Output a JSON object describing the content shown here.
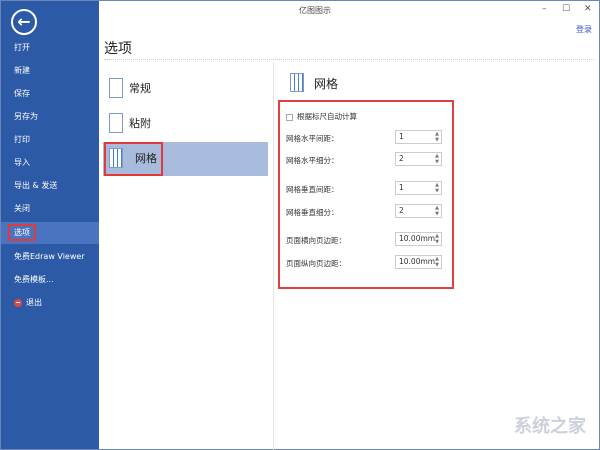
{
  "window": {
    "title": "亿图图示",
    "minimize": "–",
    "maximize": "☐",
    "close": "✕",
    "login": "登录"
  },
  "sidebar": {
    "back": "←",
    "items": [
      {
        "label": "打开"
      },
      {
        "label": "新建"
      },
      {
        "label": "保存"
      },
      {
        "label": "另存为"
      },
      {
        "label": "打印"
      },
      {
        "label": "导入"
      },
      {
        "label": "导出 & 发送"
      },
      {
        "label": "关闭"
      },
      {
        "label": "选项",
        "selected": true
      },
      {
        "label": "免费Edraw Viewer"
      },
      {
        "label": "免费模板..."
      },
      {
        "label": "退出"
      }
    ]
  },
  "page": {
    "title": "选项"
  },
  "categories": [
    {
      "label": "常规"
    },
    {
      "label": "粘附"
    },
    {
      "label": "网格",
      "selected": true
    }
  ],
  "panel": {
    "title": "网格",
    "auto_calc": {
      "label": "根据标尺自动计算",
      "checked": false
    },
    "fields": [
      {
        "label": "网格水平间距：",
        "value": "1"
      },
      {
        "label": "网格水平细分：",
        "value": "2"
      },
      {
        "label": "网格垂直间距：",
        "value": "1"
      },
      {
        "label": "网格垂直细分：",
        "value": "2"
      },
      {
        "label": "页面横向页边距：",
        "value": "10.00mm"
      },
      {
        "label": "页面纵向页边距：",
        "value": "10.00mm"
      }
    ]
  },
  "watermark": "系统之家"
}
